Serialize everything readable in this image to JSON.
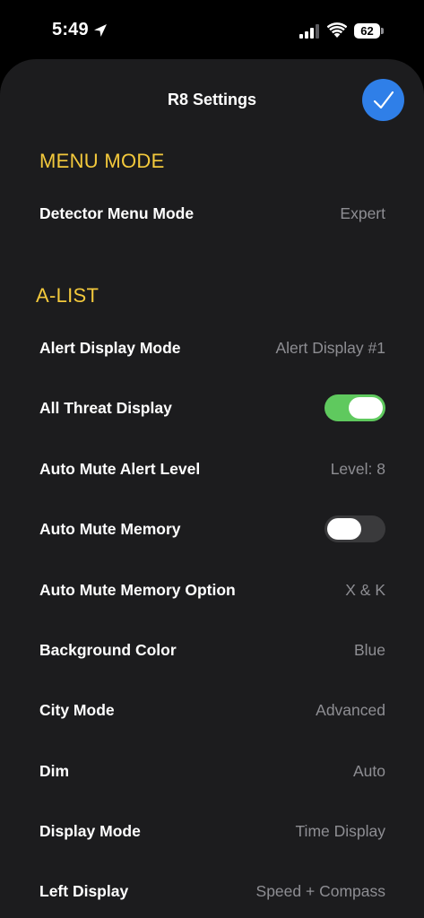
{
  "status_bar": {
    "time": "5:49",
    "battery": "62",
    "icons": [
      "location-arrow-icon",
      "cellular-signal-icon",
      "wifi-icon",
      "battery-icon"
    ]
  },
  "header": {
    "title": "R8 Settings",
    "done_icon": "checkmark-icon"
  },
  "sections": {
    "menu_mode": {
      "title": "MENU MODE",
      "rows": {
        "detector_menu_mode": {
          "label": "Detector Menu Mode",
          "value": "Expert"
        }
      }
    },
    "a_list": {
      "title": "A-LIST",
      "rows": {
        "alert_display_mode": {
          "label": "Alert Display Mode",
          "value": "Alert Display #1"
        },
        "all_threat_display": {
          "label": "All Threat Display",
          "toggle": true
        },
        "auto_mute_alert_level": {
          "label": "Auto Mute Alert Level",
          "value": "Level: 8"
        },
        "auto_mute_memory": {
          "label": "Auto Mute Memory",
          "toggle": false
        },
        "auto_mute_memory_option": {
          "label": "Auto Mute Memory Option",
          "value": "X & K"
        },
        "background_color": {
          "label": "Background Color",
          "value": "Blue"
        },
        "city_mode": {
          "label": "City Mode",
          "value": "Advanced"
        },
        "dim": {
          "label": "Dim",
          "value": "Auto"
        },
        "display_mode": {
          "label": "Display Mode",
          "value": "Time Display"
        },
        "left_display": {
          "label": "Left Display",
          "value": "Speed + Compass"
        }
      }
    }
  },
  "colors": {
    "background": "#000000",
    "sheet": "#1c1c1e",
    "section_header": "#f3c93c",
    "accent_blue": "#2f7fe8",
    "toggle_on": "#5fc95e",
    "toggle_off": "#3a3a3c",
    "secondary_text": "#8e8e93"
  }
}
